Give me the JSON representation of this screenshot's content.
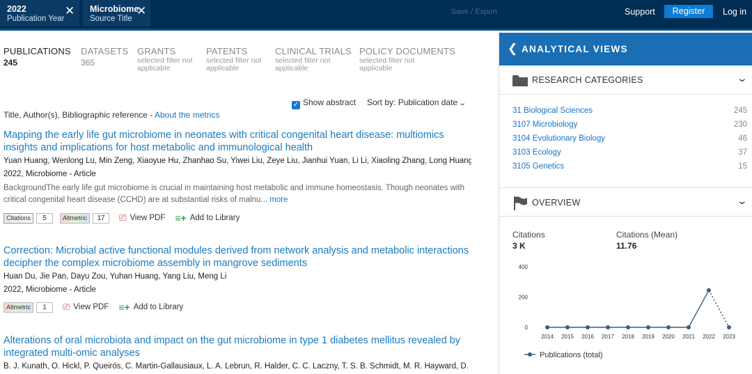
{
  "filters": [
    {
      "value": "2022",
      "key": "Publication Year"
    },
    {
      "value": "Microbiome",
      "key": "Source Title"
    }
  ],
  "header": {
    "save_export": "Save / Export",
    "support": "Support",
    "register": "Register",
    "login": "Log in"
  },
  "tabs": [
    {
      "label": "PUBLICATIONS",
      "count": "245",
      "sub": ""
    },
    {
      "label": "DATASETS",
      "count": "365",
      "sub": ""
    },
    {
      "label": "GRANTS",
      "count": "",
      "sub": "selected filter not applicable"
    },
    {
      "label": "PATENTS",
      "count": "",
      "sub": "selected filter not applicable"
    },
    {
      "label": "CLINICAL TRIALS",
      "count": "",
      "sub": "selected filter not applicable"
    },
    {
      "label": "POLICY DOCUMENTS",
      "count": "",
      "sub": "selected filter not applicable"
    }
  ],
  "controls": {
    "show_abstract": "Show abstract",
    "sort_by": "Sort by:",
    "sort_value": "Publication date"
  },
  "list_header": {
    "text": "Title, Author(s), Bibliographic reference - ",
    "link": "About the metrics"
  },
  "results": [
    {
      "title": "Mapping the early life gut microbiome in neonates with critical congenital heart disease: multiomics insights and implications for host metabolic and immunological health",
      "authors": "Yuan Huang, Wenlong Lu, Min Zeng, Xiaoyue Hu, Zhanhao Su, Yiwei Liu, Zeye Liu, Jianhui Yuan, Li Li, Xiaoling Zhang, Long Huang...",
      "meta": "2022, Microbiome - Article",
      "abstract": "BackgroundThe early life gut microbiome is crucial in maintaining host metabolic and immune homeostasis. Though neonates with critical congenital heart disease (CCHD) are at substantial risks of malnu...",
      "more": "more",
      "citations_badge": "Citations",
      "citations": "5",
      "altmetric_badge": "Altmetric",
      "altmetric": "17",
      "view_pdf": "View PDF",
      "add_library": "Add to Library"
    },
    {
      "title": "Correction: Microbial active functional modules derived from network analysis and metabolic interactions decipher the complex microbiome assembly in mangrove sediments",
      "authors": "Huan Du, Jie Pan, Dayu Zou, Yuhan Huang, Yang Liu, Meng Li",
      "meta": "2022, Microbiome - Article",
      "altmetric_badge": "Altmetric",
      "altmetric": "1",
      "view_pdf": "View PDF",
      "add_library": "Add to Library"
    },
    {
      "title": "Alterations of oral microbiota and impact on the gut microbiome in type 1 diabetes mellitus revealed by integrated multi-omic analyses",
      "authors": "B. J. Kunath, O. Hickl, P. Queirós, C. Martin-Gallausiaux, L. A. Lebrun, R. Halder, C. C. Laczny, T. S. B. Schmidt, M. R. Hayward, D. B..."
    }
  ],
  "panel": {
    "title": "ANALYTICAL VIEWS",
    "research_categories": "RESEARCH CATEGORIES",
    "categories": [
      {
        "name": "31 Biological Sciences",
        "count": "245"
      },
      {
        "name": "3107 Microbiology",
        "count": "230"
      },
      {
        "name": "3104 Evolutionary Biology",
        "count": "46"
      },
      {
        "name": "3103 Ecology",
        "count": "37"
      },
      {
        "name": "3105 Genetics",
        "count": "15"
      }
    ],
    "overview": "OVERVIEW",
    "citations_label": "Citations",
    "citations_value": "3 K",
    "citations_mean_label": "Citations (Mean)",
    "citations_mean_value": "11.76"
  },
  "colors": {
    "topbar": "#002d54",
    "accent": "#1a6fb4",
    "link": "#1b7bc0",
    "line": "#3a5f7f"
  },
  "chart_data": {
    "type": "line",
    "x": [
      "2014",
      "2015",
      "2016",
      "2017",
      "2018",
      "2019",
      "2020",
      "2021",
      "2022",
      "2023"
    ],
    "series": [
      {
        "name": "Publications (total)",
        "values": [
          0,
          0,
          0,
          0,
          0,
          0,
          0,
          0,
          245,
          0
        ]
      }
    ],
    "yticks": [
      0,
      200,
      400
    ],
    "ylim": [
      0,
      400
    ],
    "last_segment_dotted": true,
    "legend": "bottom"
  }
}
